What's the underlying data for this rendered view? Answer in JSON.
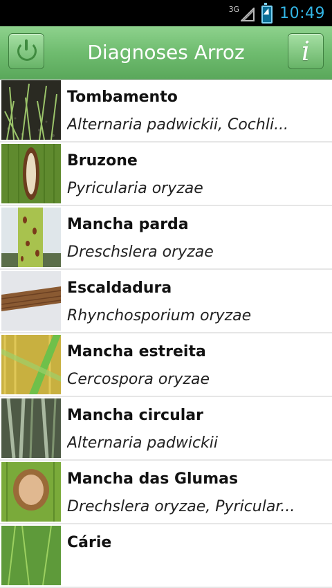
{
  "status_bar": {
    "network": "3G",
    "time": "10:49"
  },
  "action_bar": {
    "title": "Diagnoses Arroz",
    "left_icon": "power-icon",
    "right_icon": "info-icon",
    "info_glyph": "i"
  },
  "list": {
    "items": [
      {
        "title": "Tombamento",
        "subtitle": "Alternaria padwickii, Cochli..."
      },
      {
        "title": "Bruzone",
        "subtitle": "Pyricularia oryzae"
      },
      {
        "title": "Mancha parda",
        "subtitle": "Dreschslera oryzae"
      },
      {
        "title": "Escaldadura",
        "subtitle": "Rhynchosporium oryzae"
      },
      {
        "title": "Mancha estreita",
        "subtitle": "Cercospora oryzae"
      },
      {
        "title": "Mancha circular",
        "subtitle": "Alternaria padwickii"
      },
      {
        "title": "Mancha das Glumas",
        "subtitle": "Drechslera oryzae, Pyricular..."
      },
      {
        "title": "Cárie",
        "subtitle": ""
      }
    ]
  },
  "colors": {
    "action_bar": "#6fbc6f",
    "clock": "#33b5e5"
  }
}
